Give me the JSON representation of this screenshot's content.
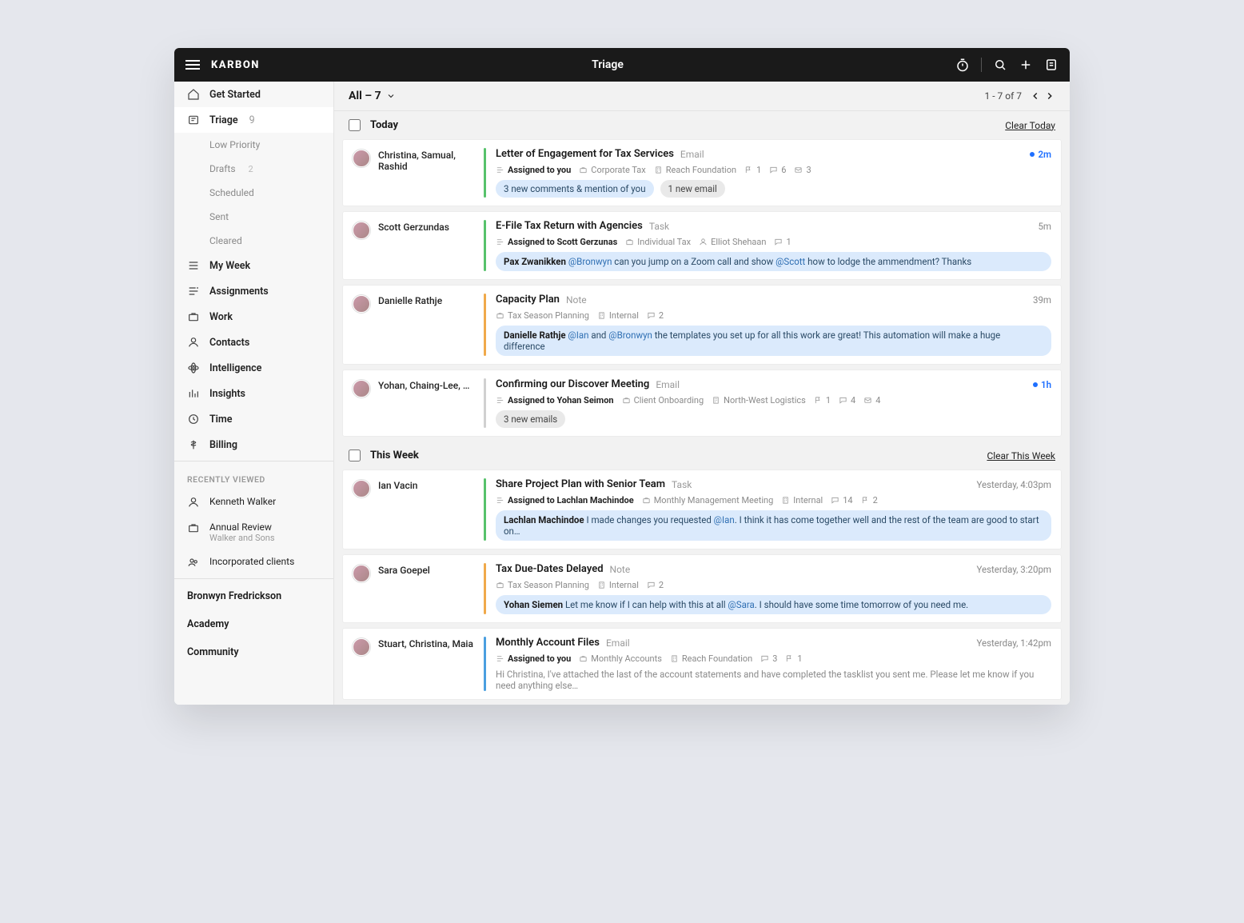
{
  "brand": "KARBON",
  "page_title": "Triage",
  "filter": {
    "label": "All – 7"
  },
  "pager": {
    "range": "1 - 7 of 7"
  },
  "sidebar": {
    "items": [
      {
        "label": "Get Started"
      },
      {
        "label": "Triage",
        "count": "9"
      },
      {
        "label": "Low Priority"
      },
      {
        "label": "Drafts",
        "count": "2"
      },
      {
        "label": "Scheduled"
      },
      {
        "label": "Sent"
      },
      {
        "label": "Cleared"
      },
      {
        "label": "My Week"
      },
      {
        "label": "Assignments"
      },
      {
        "label": "Work"
      },
      {
        "label": "Contacts"
      },
      {
        "label": "Intelligence"
      },
      {
        "label": "Insights"
      },
      {
        "label": "Time"
      },
      {
        "label": "Billing"
      }
    ],
    "recent_header": "RECENTLY VIEWED",
    "recent": [
      {
        "label": "Kenneth Walker"
      },
      {
        "label": "Annual Review",
        "sub": "Walker and Sons"
      },
      {
        "label": "Incorporated clients"
      }
    ],
    "footer": [
      {
        "label": "Bronwyn Fredrickson"
      },
      {
        "label": "Academy"
      },
      {
        "label": "Community"
      }
    ]
  },
  "groups": [
    {
      "label": "Today",
      "clear": "Clear Today"
    },
    {
      "label": "This Week",
      "clear": "Clear This Week"
    }
  ],
  "items_today": [
    {
      "from": "Christina, Samual, Rashid",
      "accent": "green",
      "subject": "Letter of Engagement for Tax Services",
      "type": "Email",
      "time": "2m",
      "time_blue": true,
      "assignee": "Assigned to you",
      "meta": [
        {
          "icon": "briefcase",
          "text": "Corporate Tax"
        },
        {
          "icon": "building",
          "text": "Reach Foundation"
        },
        {
          "icon": "flag",
          "text": "1"
        },
        {
          "icon": "chat",
          "text": "6"
        },
        {
          "icon": "mail",
          "text": "3"
        }
      ],
      "pills": [
        {
          "style": "blue",
          "text": "3 new comments & mention of you"
        },
        {
          "style": "grey",
          "text": "1 new email"
        }
      ]
    },
    {
      "from": "Scott Gerzundas",
      "accent": "green",
      "subject": "E-File Tax Return with Agencies",
      "type": "Task",
      "time": "5m",
      "assignee": "Assigned to Scott Gerzunas",
      "meta": [
        {
          "icon": "briefcase",
          "text": "Individual Tax"
        },
        {
          "icon": "person",
          "text": "Elliot Shehaan"
        },
        {
          "icon": "chat",
          "text": "1"
        }
      ],
      "quote": {
        "speaker": "Pax Zwanikken",
        "parts": [
          {
            "type": "mention",
            "text": "@Bronwyn"
          },
          {
            "type": "text",
            "text": " can you jump on a Zoom call and show "
          },
          {
            "type": "mention",
            "text": "@Scott"
          },
          {
            "type": "text",
            "text": " how to lodge the ammendment? Thanks"
          }
        ]
      }
    },
    {
      "from": "Danielle Rathje",
      "accent": "amber",
      "subject": "Capacity Plan",
      "type": "Note",
      "time": "39m",
      "meta": [
        {
          "icon": "briefcase",
          "text": "Tax Season Planning"
        },
        {
          "icon": "building",
          "text": "Internal"
        },
        {
          "icon": "chat",
          "text": "2"
        }
      ],
      "quote": {
        "speaker": "Danielle Rathje",
        "parts": [
          {
            "type": "mention",
            "text": "@Ian"
          },
          {
            "type": "text",
            "text": " and "
          },
          {
            "type": "mention",
            "text": "@Bronwyn"
          },
          {
            "type": "text",
            "text": " the templates you set up for all this work are great! This automation will make a huge difference"
          }
        ]
      }
    },
    {
      "from": "Yohan, Chaing-Lee, …",
      "accent": "grey",
      "subject": "Confirming our Discover Meeting",
      "type": "Email",
      "time": "1h",
      "time_blue": true,
      "assignee": "Assigned to Yohan Seimon",
      "meta": [
        {
          "icon": "briefcase",
          "text": "Client Onboarding"
        },
        {
          "icon": "building",
          "text": "North-West Logistics"
        },
        {
          "icon": "flag",
          "text": "1"
        },
        {
          "icon": "chat",
          "text": "4"
        },
        {
          "icon": "mail",
          "text": "4"
        }
      ],
      "pills": [
        {
          "style": "grey",
          "text": "3 new emails"
        }
      ]
    }
  ],
  "items_week": [
    {
      "from": "Ian Vacin",
      "accent": "green",
      "subject": "Share Project Plan with Senior Team",
      "type": "Task",
      "time": "Yesterday, 4:03pm",
      "assignee": "Assigned to Lachlan Machindoe",
      "meta": [
        {
          "icon": "briefcase",
          "text": "Monthly Management Meeting"
        },
        {
          "icon": "building",
          "text": "Internal"
        },
        {
          "icon": "chat",
          "text": "14"
        },
        {
          "icon": "flag",
          "text": "2"
        }
      ],
      "quote": {
        "speaker": "Lachlan Machindoe",
        "parts": [
          {
            "type": "text",
            "text": " I made changes you requested "
          },
          {
            "type": "mention",
            "text": "@Ian"
          },
          {
            "type": "text",
            "text": ". I think it has come together well and the rest of the team are good to start on…"
          }
        ]
      }
    },
    {
      "from": "Sara Goepel",
      "accent": "amber",
      "subject": "Tax Due-Dates Delayed",
      "type": "Note",
      "time": "Yesterday, 3:20pm",
      "meta": [
        {
          "icon": "briefcase",
          "text": "Tax Season Planning"
        },
        {
          "icon": "building",
          "text": "Internal"
        },
        {
          "icon": "chat",
          "text": "2"
        }
      ],
      "quote": {
        "speaker": "Yohan Siemen",
        "parts": [
          {
            "type": "text",
            "text": " Let me know if I can help with this at all "
          },
          {
            "type": "mention",
            "text": "@Sara"
          },
          {
            "type": "text",
            "text": ". I should have some time tomorrow of you need me."
          }
        ]
      }
    },
    {
      "from": "Stuart, Christina, Maia",
      "accent": "blue",
      "subject": "Monthly Account Files",
      "type": "Email",
      "time": "Yesterday, 1:42pm",
      "assignee": "Assigned to you",
      "meta": [
        {
          "icon": "briefcase",
          "text": "Monthly Accounts"
        },
        {
          "icon": "building",
          "text": "Reach Foundation"
        },
        {
          "icon": "chat",
          "text": "3"
        },
        {
          "icon": "flag",
          "text": "1"
        }
      ],
      "preview": "Hi Christina, I've attached the last of the account statements and have completed the tasklist you sent me. Please let me know if you need anything else…"
    }
  ]
}
